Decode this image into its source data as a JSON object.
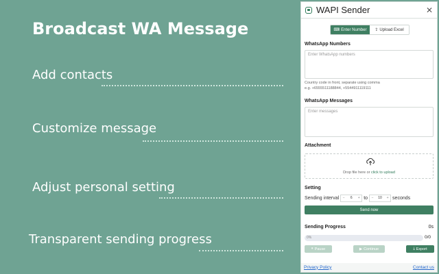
{
  "promo": {
    "title": "Broadcast WA Message",
    "features": [
      "Add contacts",
      "Customize message",
      "Adjust personal setting",
      "Transparent sending progress"
    ]
  },
  "panel": {
    "title": "WAPI Sender",
    "close": "✕",
    "tabs": [
      {
        "label": "Enter Number",
        "active": true
      },
      {
        "label": "Upload Excel",
        "active": false
      }
    ],
    "numbers_label": "WhatsApp Numbers",
    "numbers_placeholder": "Enter WhatsApp numbers",
    "numbers_hint_1": "Country code in front, separate using comma",
    "numbers_hint_2": "e.g. +6555511188844, +5544911119111",
    "messages_label": "WhatsApp Messages",
    "messages_placeholder": "Enter messages",
    "attachment_label": "Attachment",
    "drop_text": "Drop file here or ",
    "drop_link": "click to upload",
    "setting_label": "Setting",
    "sending_interval": "Sending interval",
    "interval_min": "6",
    "to": "to",
    "interval_max": "10",
    "seconds": "seconds",
    "send_now": "Send now",
    "progress_label": "Sending Progress",
    "progress_time": "0s",
    "progress_fraction": 0,
    "progress_pct": "0%",
    "progress_count": "0/0",
    "pause": "Pause",
    "continue": "Continue",
    "export": "Export",
    "privacy": "Privacy Policy",
    "contact": "Contact us"
  },
  "colors": {
    "background": "#6fa393",
    "accent": "#3f7f62",
    "disabled": "#b9d3c6"
  }
}
